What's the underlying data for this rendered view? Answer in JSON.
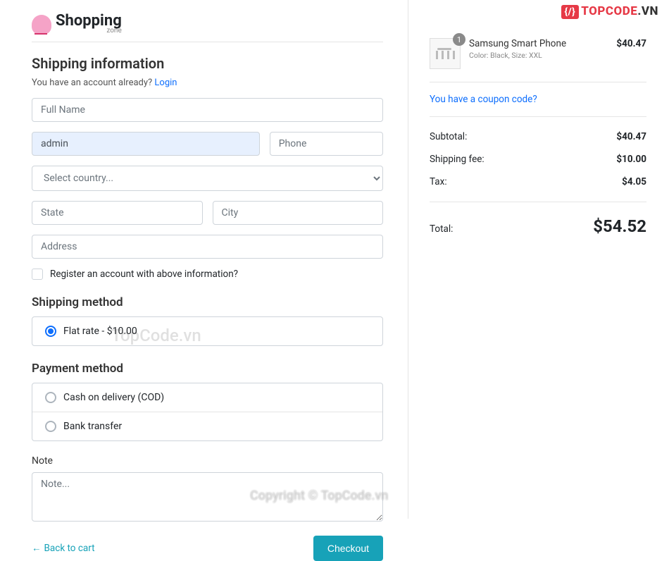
{
  "logo": {
    "main": "Shopping",
    "sub": "zone"
  },
  "brand": {
    "icon_glyph": "{/}",
    "name_red": "TOPCODE",
    "name_dark": ".VN"
  },
  "shipping_info": {
    "heading": "Shipping information",
    "hint_prefix": "You have an account already? ",
    "login_label": "Login",
    "full_name_placeholder": "Full Name",
    "email_value": "admin",
    "phone_placeholder": "Phone",
    "country_placeholder": "Select country...",
    "state_placeholder": "State",
    "city_placeholder": "City",
    "address_placeholder": "Address",
    "register_label": "Register an account with above information?"
  },
  "shipping_method": {
    "heading": "Shipping method",
    "options": [
      {
        "label": "Flat rate - $10.00",
        "selected": true
      }
    ]
  },
  "payment_method": {
    "heading": "Payment method",
    "options": [
      {
        "label": "Cash on delivery (COD)",
        "selected": false
      },
      {
        "label": "Bank transfer",
        "selected": false
      }
    ]
  },
  "note": {
    "label": "Note",
    "placeholder": "Note..."
  },
  "actions": {
    "back": "Back to cart",
    "checkout": "Checkout"
  },
  "cart": {
    "items": [
      {
        "qty": "1",
        "name": "Samsung Smart Phone",
        "meta": "Color: Black, Size: XXL",
        "price": "$40.47"
      }
    ],
    "coupon_link": "You have a coupon code?",
    "subtotal_label": "Subtotal:",
    "subtotal": "$40.47",
    "shipping_label": "Shipping fee:",
    "shipping": "$10.00",
    "tax_label": "Tax:",
    "tax": "$4.05",
    "total_label": "Total:",
    "total": "$54.52"
  },
  "watermarks": {
    "wm1": "TopCode.vn",
    "wm2": "Copyright © TopCode.vn"
  }
}
